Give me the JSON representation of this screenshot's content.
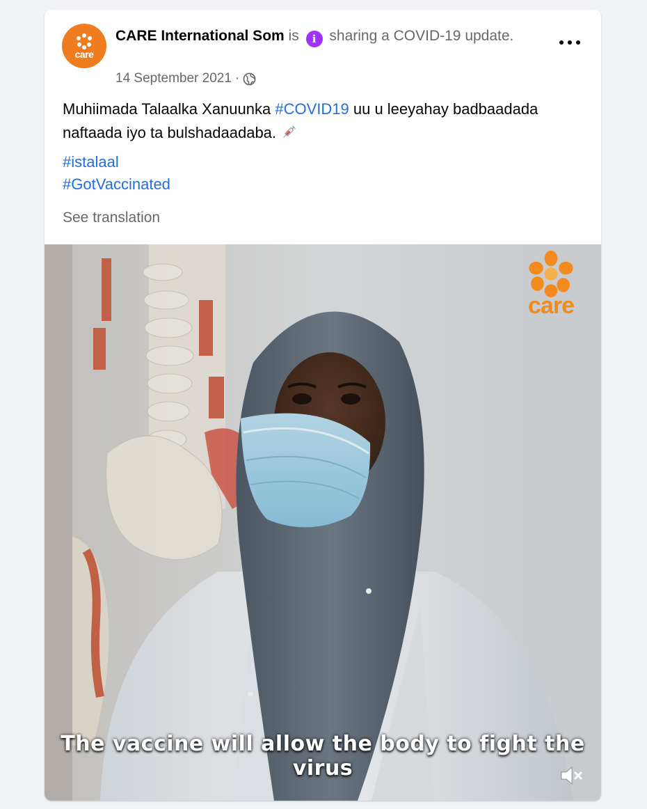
{
  "post": {
    "page_name": "CARE International Som",
    "status_prefix": "is",
    "status_text": "sharing a COVID-19 update.",
    "date": "14 September 2021",
    "separator": "·",
    "avatar_word": "care",
    "body": {
      "text_before": "Muhiimada Talaalka Xanuunka ",
      "hashtag": "#COVID19",
      "text_after": " uu u leeyahay badbaadada naftaada iyo ta bulshadaadaba. "
    },
    "tags": [
      "#istalaal",
      "#GotVaccinated"
    ],
    "see_translation": "See translation",
    "video": {
      "subtitle": "The vaccine will allow the body to fight the virus",
      "watermark_word": "care"
    }
  },
  "colors": {
    "link": "#216fdb",
    "brand_orange": "#ef7d1f",
    "info_purple": "#a033ff",
    "secondary_text": "#65676b",
    "background": "#f0f2f5"
  },
  "icons": {
    "info": "info-icon",
    "audience": "globe-icon",
    "more": "more-options-icon",
    "mute": "muted-speaker-icon",
    "emoji": "syringe-icon"
  }
}
